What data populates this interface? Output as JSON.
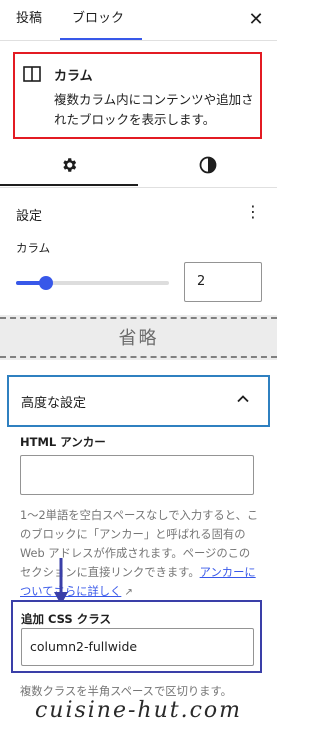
{
  "tabs": {
    "post": "投稿",
    "block": "ブロック"
  },
  "block_card": {
    "title": "カラム",
    "description": "複数カラム内にコンテンツや追加されたブロックを表示します。"
  },
  "settings": {
    "title": "設定",
    "columns_label": "カラム",
    "columns_value": "2",
    "slider_fraction": 0.2
  },
  "omitted_text": "省略",
  "advanced": {
    "title": "高度な設定",
    "html_anchor_label": "HTML アンカー",
    "help_text": "1〜2単語を空白スペースなしで入力すると、このブロックに「アンカー」と呼ばれる固有のWeb アドレスが作成されます。ページのこのセクションに直接リンクできます。",
    "help_link": "アンカーについてさらに詳しく",
    "css_class_label": "追加 CSS クラス",
    "css_class_value": "column2-fullwide",
    "css_class_help": "複数クラスを半角スペースで区切ります。"
  },
  "watermark": "cuisine-hut.com",
  "colors": {
    "accent": "#3858e9",
    "card_border": "#e31b23",
    "advanced_border": "#2f80c0",
    "css_box_border": "#3a3fa8"
  },
  "icons": [
    "close-icon",
    "columns-icon",
    "gear-icon",
    "contrast-icon",
    "more-vertical-icon",
    "chevron-up-icon",
    "external-link-icon",
    "arrow-down-icon"
  ]
}
